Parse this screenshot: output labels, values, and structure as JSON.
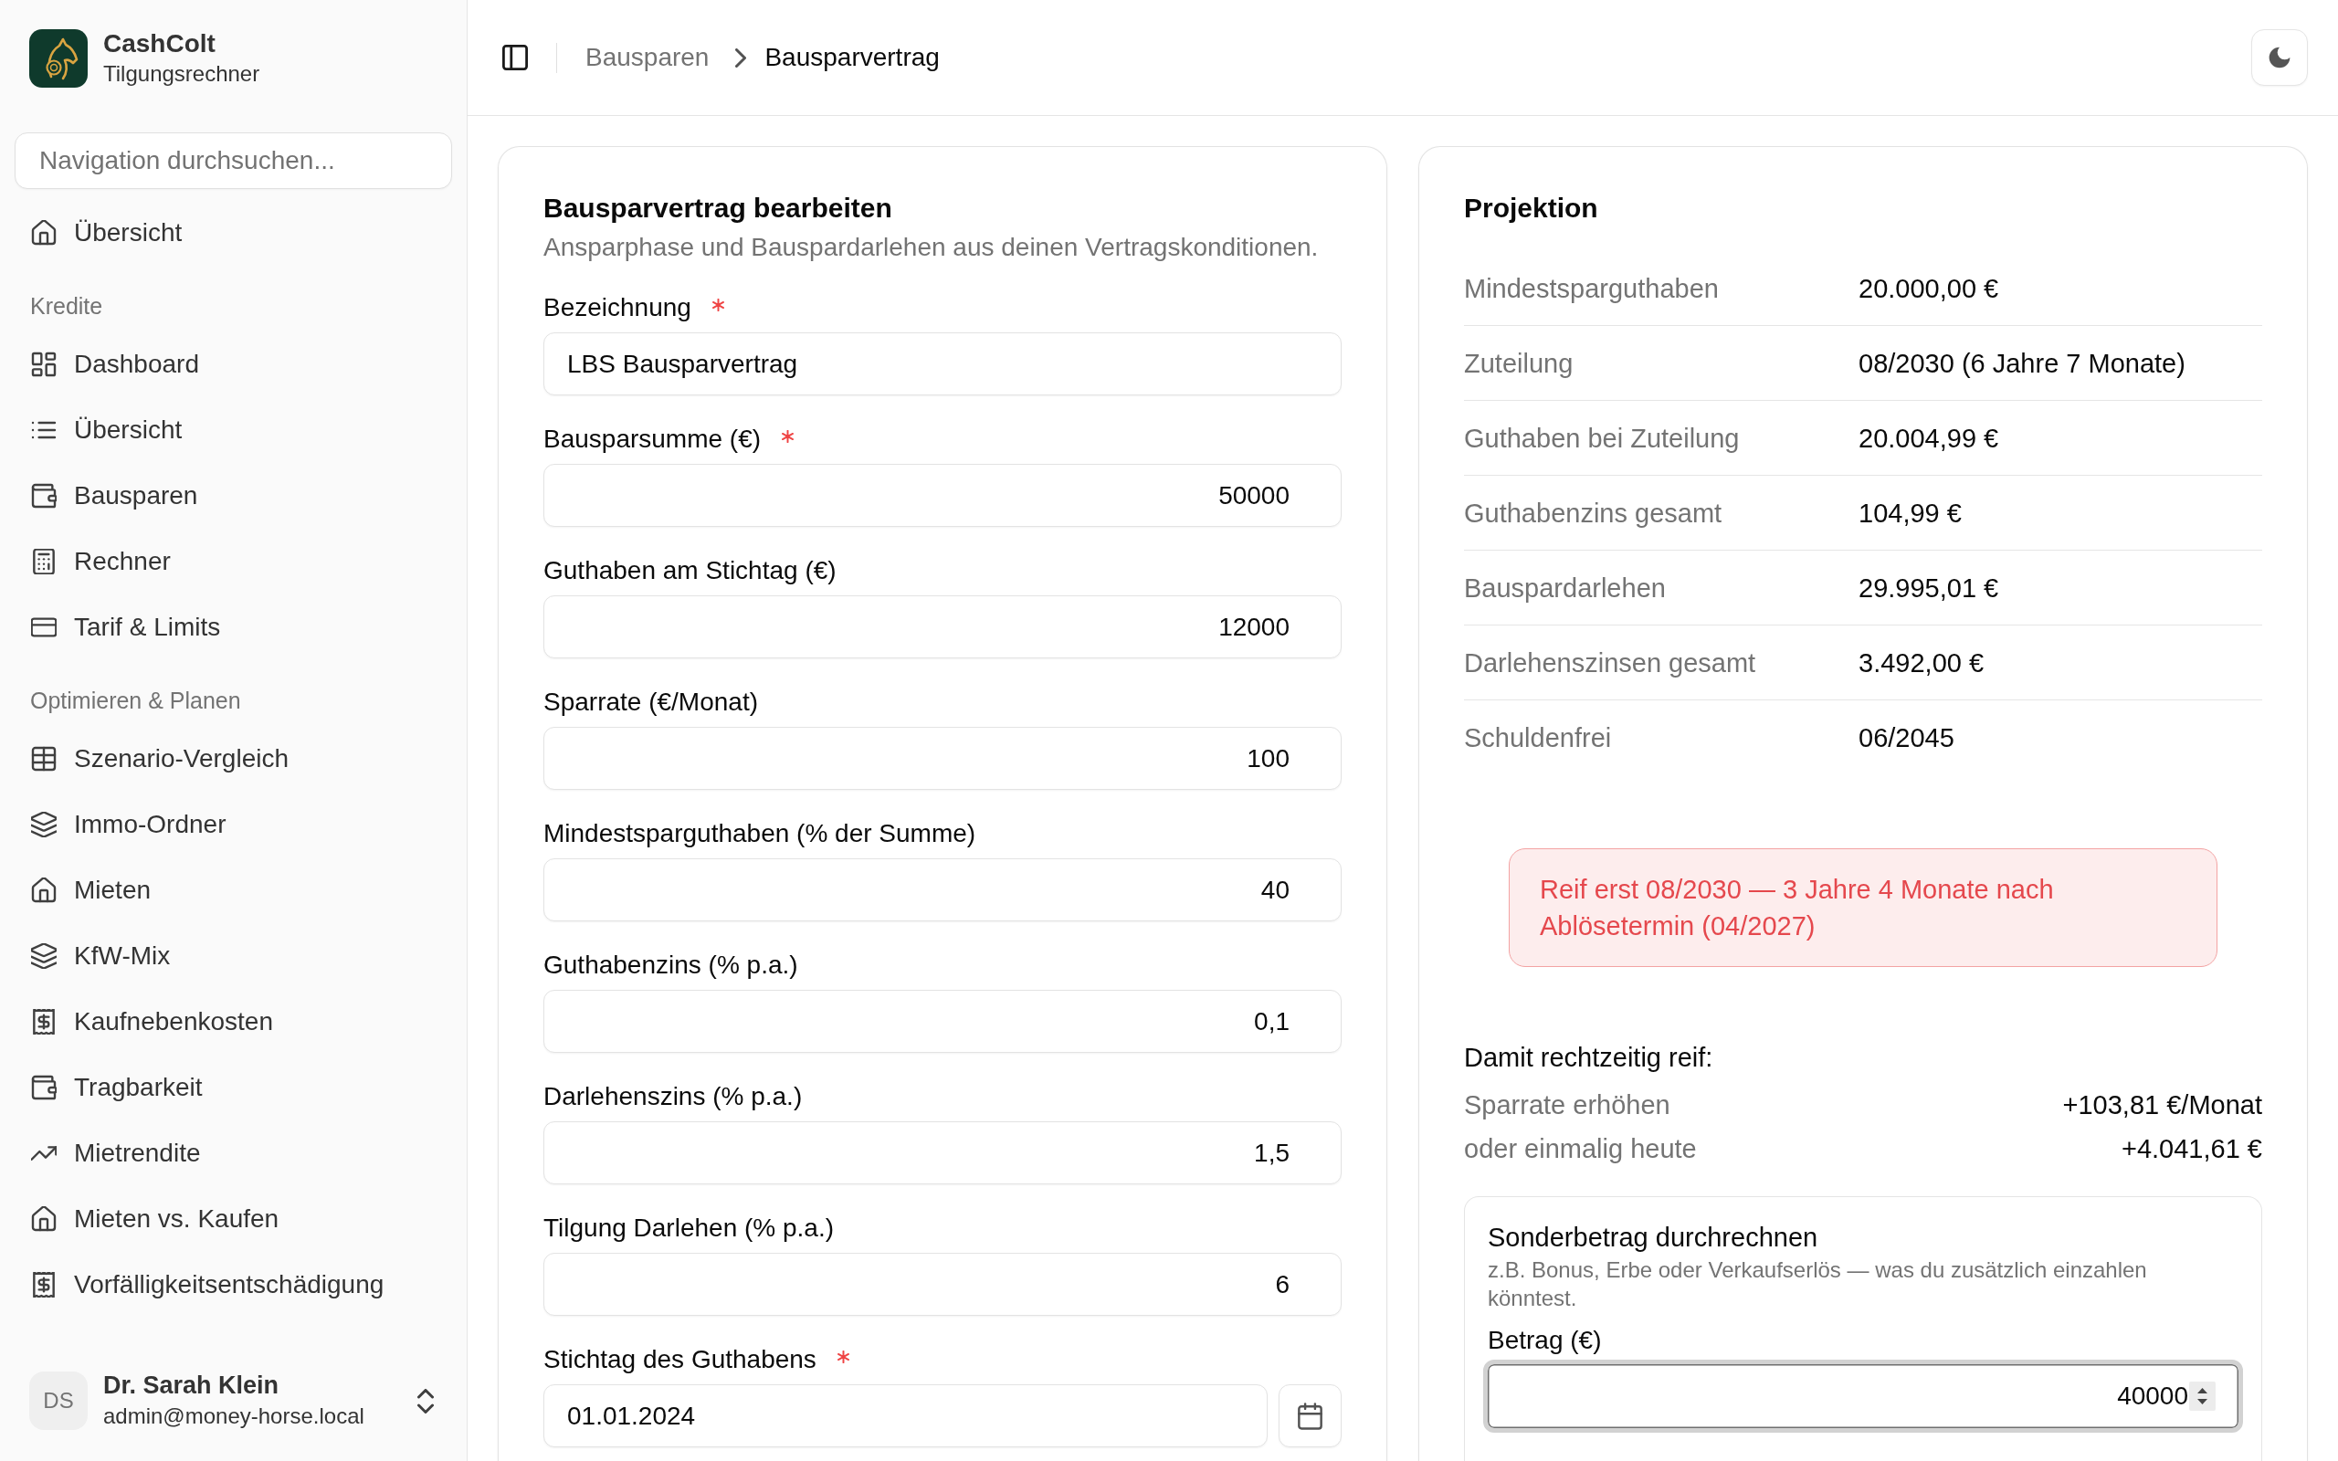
{
  "sidebar": {
    "brand": {
      "name": "CashColt",
      "subtitle": "Tilgungsrechner"
    },
    "search": {
      "placeholder": "Navigation durchsuchen..."
    },
    "items": [
      {
        "label": "Übersicht",
        "kind": "house"
      }
    ],
    "groups": [
      {
        "title": "Kredite",
        "items": [
          {
            "label": "Dashboard",
            "kind": "dashboard"
          },
          {
            "label": "Übersicht",
            "kind": "list"
          },
          {
            "label": "Bausparen",
            "kind": "wallet"
          },
          {
            "label": "Rechner",
            "kind": "calculator"
          },
          {
            "label": "Tarif & Limits",
            "kind": "card"
          }
        ]
      },
      {
        "title": "Optimieren & Planen",
        "items": [
          {
            "label": "Szenario-Vergleich",
            "kind": "table"
          },
          {
            "label": "Immo-Ordner",
            "kind": "layers"
          },
          {
            "label": "Mieten",
            "kind": "house"
          },
          {
            "label": "KfW-Mix",
            "kind": "layers"
          },
          {
            "label": "Kaufnebenkosten",
            "kind": "receipt"
          },
          {
            "label": "Tragbarkeit",
            "kind": "wallet"
          },
          {
            "label": "Mietrendite",
            "kind": "trend"
          },
          {
            "label": "Mieten vs. Kaufen",
            "kind": "house"
          },
          {
            "label": "Vorfälligkeitsentschädigung",
            "kind": "receipt"
          }
        ]
      }
    ],
    "user": {
      "initials": "DS",
      "name": "Dr. Sarah Klein",
      "email": "admin@money-horse.local"
    }
  },
  "header": {
    "breadcrumb": [
      {
        "label": "Bausparen",
        "current": false
      },
      {
        "label": "Bausparvertrag",
        "current": true
      }
    ]
  },
  "form": {
    "title": "Bausparvertrag bearbeiten",
    "subtitle": "Ansparphase und Bauspardarlehen aus deinen Vertragskonditionen.",
    "fields": [
      {
        "label": "Bezeichnung",
        "kind": "text",
        "required": true,
        "value": "LBS Bausparvertrag"
      },
      {
        "label": "Bausparsumme (€)",
        "kind": "number",
        "required": true,
        "value": "50000"
      },
      {
        "label": "Guthaben am Stichtag (€)",
        "kind": "number",
        "required": false,
        "value": "12000"
      },
      {
        "label": "Sparrate (€/Monat)",
        "kind": "number",
        "required": false,
        "value": "100"
      },
      {
        "label": "Mindestsparguthaben (% der Summe)",
        "kind": "number",
        "required": false,
        "value": "40"
      },
      {
        "label": "Guthabenzins (% p.a.)",
        "kind": "number",
        "required": false,
        "value": "0,1"
      },
      {
        "label": "Darlehenszins (% p.a.)",
        "kind": "number",
        "required": false,
        "value": "1,5"
      },
      {
        "label": "Tilgung Darlehen (% p.a.)",
        "kind": "number",
        "required": false,
        "value": "6"
      },
      {
        "label": "Stichtag des Guthabens",
        "kind": "date",
        "required": true,
        "value": "01.01.2024"
      }
    ]
  },
  "projection": {
    "title": "Projektion",
    "rows": [
      {
        "label": "Mindestsparguthaben",
        "value": "20.000,00 €"
      },
      {
        "label": "Zuteilung",
        "value": "08/2030 (6 Jahre 7 Monate)"
      },
      {
        "label": "Guthaben bei Zuteilung",
        "value": "20.004,99 €"
      },
      {
        "label": "Guthabenzins gesamt",
        "value": "104,99 €"
      },
      {
        "label": "Bauspardarlehen",
        "value": "29.995,01 €"
      },
      {
        "label": "Darlehenszinsen gesamt",
        "value": "3.492,00 €"
      },
      {
        "label": "Schuldenfrei",
        "value": "06/2045"
      }
    ],
    "alert": {
      "text": "Reif erst 08/2030 — 3 Jahre 4 Monate nach Ablösetermin (04/2027)"
    },
    "fixes": {
      "title": "Damit rechtzeitig reif:",
      "rows": [
        {
          "label": "Sparrate erhöhen",
          "value": "+103,81 €/Monat"
        },
        {
          "label": "oder einmalig heute",
          "value": "+4.041,61 €"
        }
      ]
    },
    "special": {
      "title": "Sonderbetrag durchrechnen",
      "description": "z.B. Bonus, Erbe oder Verkaufserlös — was du zusätzlich einzahlen könntest.",
      "field": {
        "label": "Betrag (€)",
        "kind": "number",
        "value": "40000",
        "focused": true
      }
    }
  }
}
